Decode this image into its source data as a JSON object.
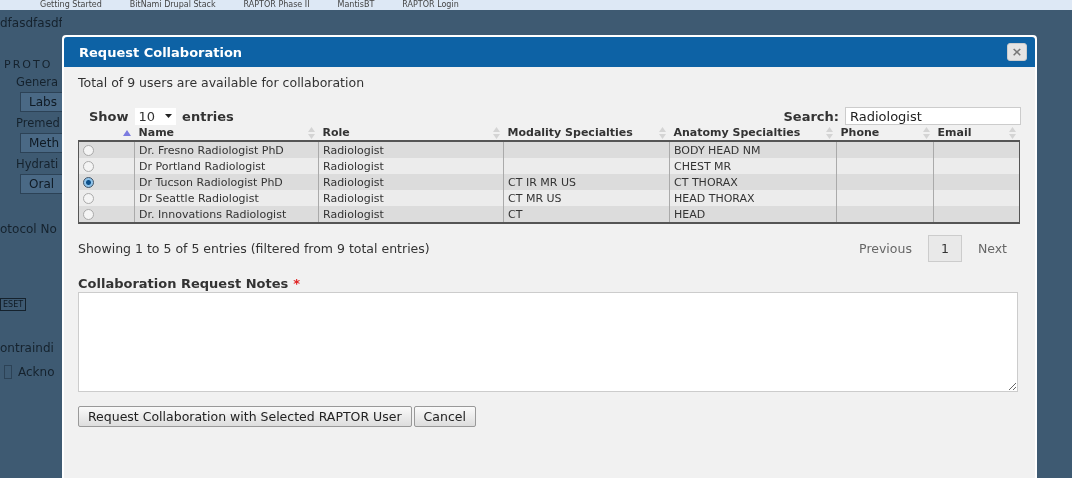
{
  "bookmarks": [
    "Getting Started",
    "BitNami Drupal Stack",
    "RAPTOR Phase II",
    "MantisBT",
    "RAPTOR Login"
  ],
  "background_page": {
    "header": "dfasdfasdf",
    "section": "PROTO",
    "fields": [
      {
        "label": "Genera",
        "value": "Labs"
      },
      {
        "label": "Premed",
        "value": "Meth"
      },
      {
        "label": "Hydrati",
        "value": "Oral"
      }
    ],
    "notes_label": "otocol No",
    "reset": "ESET",
    "contra": "ontraindi",
    "ack": {
      "label": "Ackno",
      "checked": false
    }
  },
  "dialog": {
    "title": "Request Collaboration",
    "close": "×",
    "summary": "Total of 9 users are available for collaboration",
    "length": {
      "before": "Show",
      "value": "10",
      "after": "entries"
    },
    "search": {
      "label": "Search:",
      "value": "Radiologist"
    },
    "columns": [
      {
        "sorted": true
      },
      {
        "label": "Name",
        "sorted": false
      },
      {
        "label": "Role",
        "sorted": false
      },
      {
        "label": "Modality Specialties",
        "sorted": false
      },
      {
        "label": "Anatomy Specialties",
        "sorted": false
      },
      {
        "label": "Phone",
        "sorted": false
      },
      {
        "label": "Email",
        "sorted": false
      }
    ],
    "rows": [
      {
        "selected": false,
        "name": "Dr. Fresno Radiologist PhD",
        "role": "Radiologist",
        "anatomy": "BODY HEAD NM"
      },
      {
        "selected": false,
        "name": "Dr Portland Radiologist",
        "role": "Radiologist",
        "anatomy": "CHEST MR"
      },
      {
        "selected": true,
        "name": "Dr Tucson Radiologist PhD",
        "role": "Radiologist",
        "modality": "CT IR MR US",
        "anatomy": "CT THORAX"
      },
      {
        "selected": false,
        "name": "Dr Seattle Radiologist",
        "role": "Radiologist",
        "modality": "CT MR US",
        "anatomy": "HEAD THORAX"
      },
      {
        "selected": false,
        "name": "Dr. Innovations Radiologist",
        "role": "Radiologist",
        "modality": "CT",
        "anatomy": "HEAD"
      }
    ],
    "info": "Showing 1 to 5 of 5 entries (filtered from 9 total entries)",
    "pagination": {
      "previous": "Previous",
      "pages": [
        {
          "label": "1",
          "selected": true
        }
      ],
      "next": "Next"
    },
    "notes": {
      "label": "Collaboration Request Notes",
      "required": "*"
    },
    "buttons": [
      {
        "label": "Request Collaboration with Selected RAPTOR User"
      },
      {
        "label": "Cancel"
      }
    ]
  }
}
